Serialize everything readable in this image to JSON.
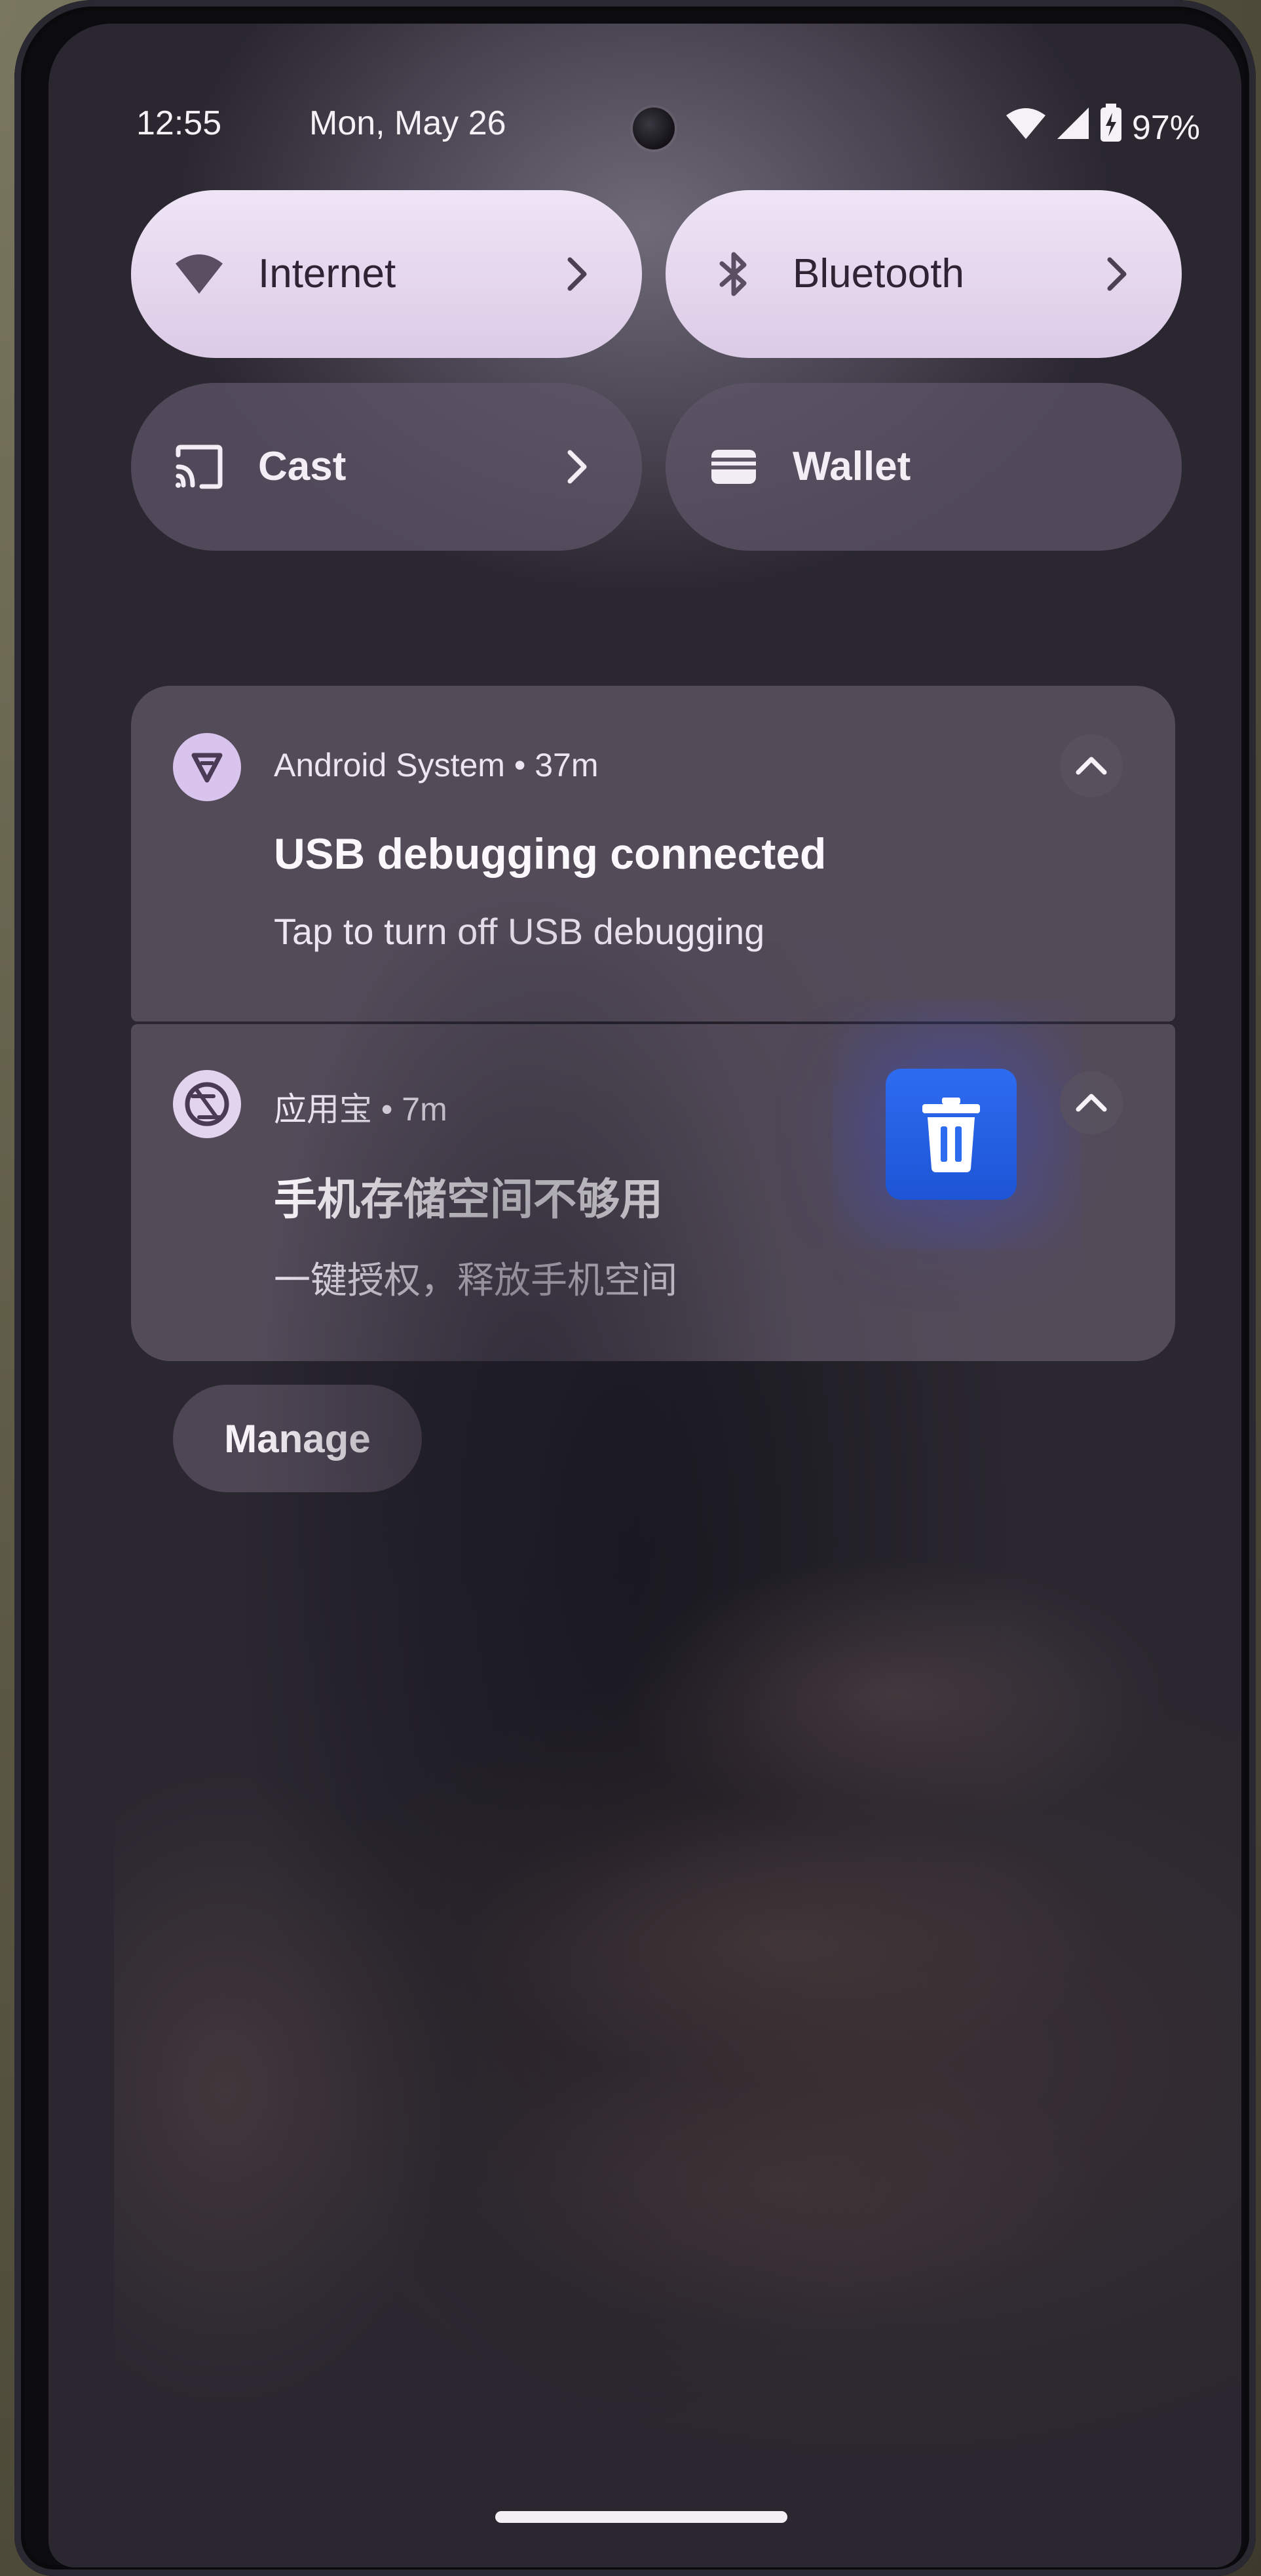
{
  "status_bar": {
    "time": "12:55",
    "date": "Mon, May 26",
    "battery_percent": "97%",
    "icons": [
      "wifi-icon",
      "cellular-signal-icon",
      "battery-charging-icon"
    ]
  },
  "quick_tiles": {
    "internet": {
      "label": "Internet",
      "icon": "wifi-icon",
      "state": "on"
    },
    "bluetooth": {
      "label": "Bluetooth",
      "icon": "bluetooth-icon",
      "state": "on"
    },
    "cast": {
      "label": "Cast",
      "icon": "cast-icon",
      "state": "off"
    },
    "wallet": {
      "label": "Wallet",
      "icon": "wallet-icon",
      "state": "off"
    }
  },
  "notifications": [
    {
      "app_name": "Android System",
      "time_ago": "37m",
      "header": "Android System • 37m",
      "title": "USB debugging connected",
      "body": "Tap to turn off USB debugging",
      "icon": "android-system-icon"
    },
    {
      "app_name": "应用宝",
      "time_ago": "7m",
      "header": "应用宝 • 7m",
      "title": "手机存储空间不够用",
      "body": "一键授权，释放手机空间",
      "icon": "app-store-icon",
      "action_icon": "trash-icon"
    }
  ],
  "manage_button": {
    "label": "Manage"
  },
  "colors": {
    "tile_active": "#e8dcef",
    "tile_inactive": "#5f5668",
    "notification_bg": "#766a7c",
    "trash_blue": "#2d6cf0"
  }
}
